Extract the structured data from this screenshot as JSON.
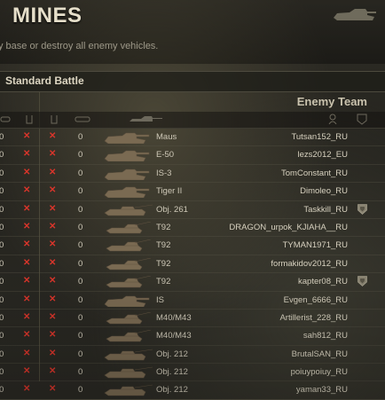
{
  "header": {
    "map_name": "MINES",
    "description": "y base or destroy all enemy vehicles."
  },
  "battle_type": "Standard Battle",
  "enemy_team_title": "Enemy Team",
  "colors": {
    "kill_mark": "#d9352b",
    "text": "#d9d4c6",
    "divider": "#4b4839"
  },
  "rows": [
    {
      "left_count": "0",
      "frags": "0",
      "vehicle": "Maus",
      "player": "Tutsan152_RU",
      "badge": false
    },
    {
      "left_count": "0",
      "frags": "0",
      "vehicle": "E-50",
      "player": "lezs2012_EU",
      "badge": false
    },
    {
      "left_count": "0",
      "frags": "0",
      "vehicle": "IS-3",
      "player": "TomConstant_RU",
      "badge": false
    },
    {
      "left_count": "0",
      "frags": "0",
      "vehicle": "Tiger II",
      "player": "Dimoleo_RU",
      "badge": false
    },
    {
      "left_count": "0",
      "frags": "0",
      "vehicle": "Obj. 261",
      "player": "Taskkill_RU",
      "badge": true
    },
    {
      "left_count": "0",
      "frags": "0",
      "vehicle": "T92",
      "player": "DRAGON_urpok_KJIAHA__RU",
      "badge": false
    },
    {
      "left_count": "0",
      "frags": "0",
      "vehicle": "T92",
      "player": "TYMAN1971_RU",
      "badge": false
    },
    {
      "left_count": "0",
      "frags": "0",
      "vehicle": "T92",
      "player": "formakidov2012_RU",
      "badge": false
    },
    {
      "left_count": "0",
      "frags": "0",
      "vehicle": "T92",
      "player": "kapter08_RU",
      "badge": true
    },
    {
      "left_count": "0",
      "frags": "0",
      "vehicle": "IS",
      "player": "Evgen_6666_RU",
      "badge": false
    },
    {
      "left_count": "0",
      "frags": "0",
      "vehicle": "M40/M43",
      "player": "Artillerist_228_RU",
      "badge": false
    },
    {
      "left_count": "0",
      "frags": "0",
      "vehicle": "M40/M43",
      "player": "sah812_RU",
      "badge": false
    },
    {
      "left_count": "0",
      "frags": "0",
      "vehicle": "Obj. 212",
      "player": "BrutalSAN_RU",
      "badge": false
    },
    {
      "left_count": "0",
      "frags": "0",
      "vehicle": "Obj. 212",
      "player": "poiuypoiuy_RU",
      "badge": false
    },
    {
      "left_count": "0",
      "frags": "0",
      "vehicle": "Obj. 212",
      "player": "yaman33_RU",
      "badge": false
    }
  ]
}
